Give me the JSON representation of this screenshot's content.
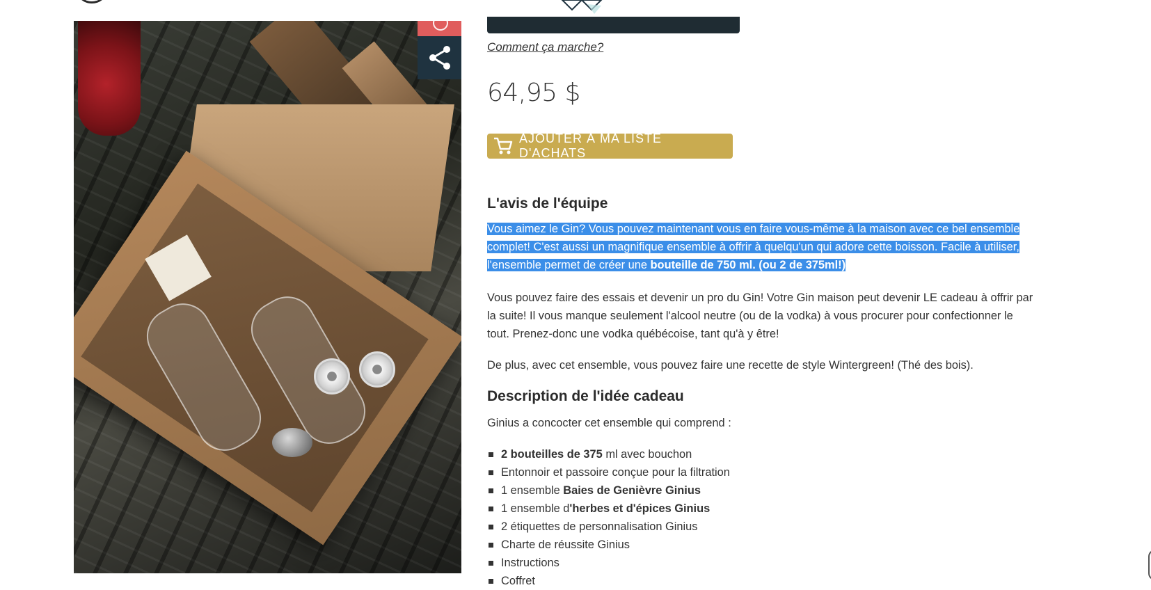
{
  "product": {
    "how_link": "Comment ça marche?",
    "price": "64,95 $",
    "add_to_cart_label": "AJOUTER À MA LISTE D'ACHATS"
  },
  "team_review": {
    "title": "L'avis de l'équipe",
    "p1_text": "Vous aimez le Gin? Vous pouvez maintenant vous en faire vous-même à la maison avec ce bel ensemble complet! C'est aussi un magnifique ensemble à offrir à quelqu'un qui adore cette boisson. Facile à utiliser, l'ensemble permet de créer une ",
    "p1_bold": "bouteille de 750 ml. (ou 2 de 375ml!)",
    "p2": "Vous pouvez faire des essais et devenir un pro du Gin! Votre Gin maison peut devenir LE cadeau à offrir par la suite! Il vous manque seulement l'alcool neutre (ou de la vodka) à vous procurer pour confectionner le tout. Prenez-donc une vodka québécoise, tant qu'à y être!",
    "p3": "De plus, avec cet ensemble, vous pouvez faire une recette de style Wintergreen! (Thé des bois)."
  },
  "description": {
    "title": "Description de l'idée cadeau",
    "intro": "Ginius a concocter cet ensemble qui comprend :",
    "items": [
      {
        "bold_prefix": "2 bouteilles de 375",
        "text": " ml avec bouchon"
      },
      {
        "text": "Entonnoir et passoire conçue pour la filtration"
      },
      {
        "text": "1 ensemble ",
        "bold_suffix": "Baies de Genièvre Ginius"
      },
      {
        "text": "1 ensemble d",
        "bold_suffix": "'herbes et d'épices Ginius"
      },
      {
        "text": "2 étiquettes de personnalisation Ginius"
      },
      {
        "text": "Charte de réussite Ginius"
      },
      {
        "text": "Instructions"
      },
      {
        "text": "Coffret"
      }
    ]
  },
  "colors": {
    "cart_button": "#c9ab50",
    "wishlist": "#e05d5d",
    "share": "#1f3340",
    "highlight": "#3b8ee8"
  },
  "icons": [
    "cart-icon",
    "share-icon",
    "heart-icon",
    "diamond-logo-icon"
  ]
}
